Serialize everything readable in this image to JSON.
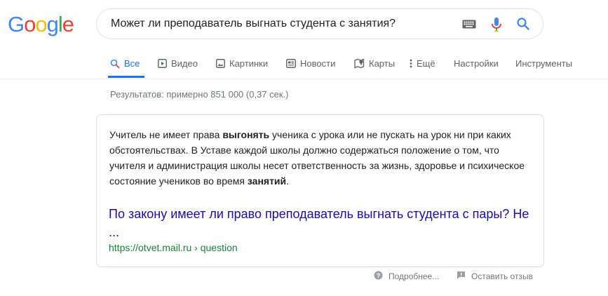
{
  "logo": {
    "text": "Google",
    "letters": [
      "G",
      "o",
      "o",
      "g",
      "l",
      "e"
    ],
    "colors": [
      "#4285F4",
      "#EA4335",
      "#FBBC05",
      "#4285F4",
      "#34A853",
      "#EA4335"
    ]
  },
  "search": {
    "query": "Может ли преподаватель выгнать студента с занятия?"
  },
  "tabs": [
    {
      "label": "Все",
      "icon": "search-icon",
      "active": true
    },
    {
      "label": "Видео",
      "icon": "video-icon"
    },
    {
      "label": "Картинки",
      "icon": "image-icon"
    },
    {
      "label": "Новости",
      "icon": "news-icon"
    },
    {
      "label": "Карты",
      "icon": "map-icon"
    },
    {
      "label": "Ещё",
      "icon": "more-icon"
    },
    {
      "label": "Настройки"
    },
    {
      "label": "Инструменты"
    }
  ],
  "stats": "Результатов: примерно 851 000 (0,37 сек.)",
  "featured_snippet": {
    "parts": [
      {
        "text": "Учитель не имеет права ",
        "bold": false
      },
      {
        "text": "выгонять",
        "bold": true
      },
      {
        "text": " ученика с урока или не пускать на урок ни при каких обстоятельствах. В Уставе каждой школы должно содержаться положение о том, что учителя и администрация школы несет ответственность за жизнь, здоровье и психическое состояние учеников во время ",
        "bold": false
      },
      {
        "text": "занятий",
        "bold": true
      },
      {
        "text": ".",
        "bold": false
      }
    ],
    "title": "По закону имеет ли право преподаватель выгнать студента с пары? Не ...",
    "url": "https://otvet.mail.ru › question"
  },
  "footer": {
    "more_label": "Подробнее...",
    "feedback_label": "Оставить отзыв"
  },
  "colors": {
    "accent": "#1a73e8",
    "link": "#1a0dab",
    "url": "#188038"
  }
}
